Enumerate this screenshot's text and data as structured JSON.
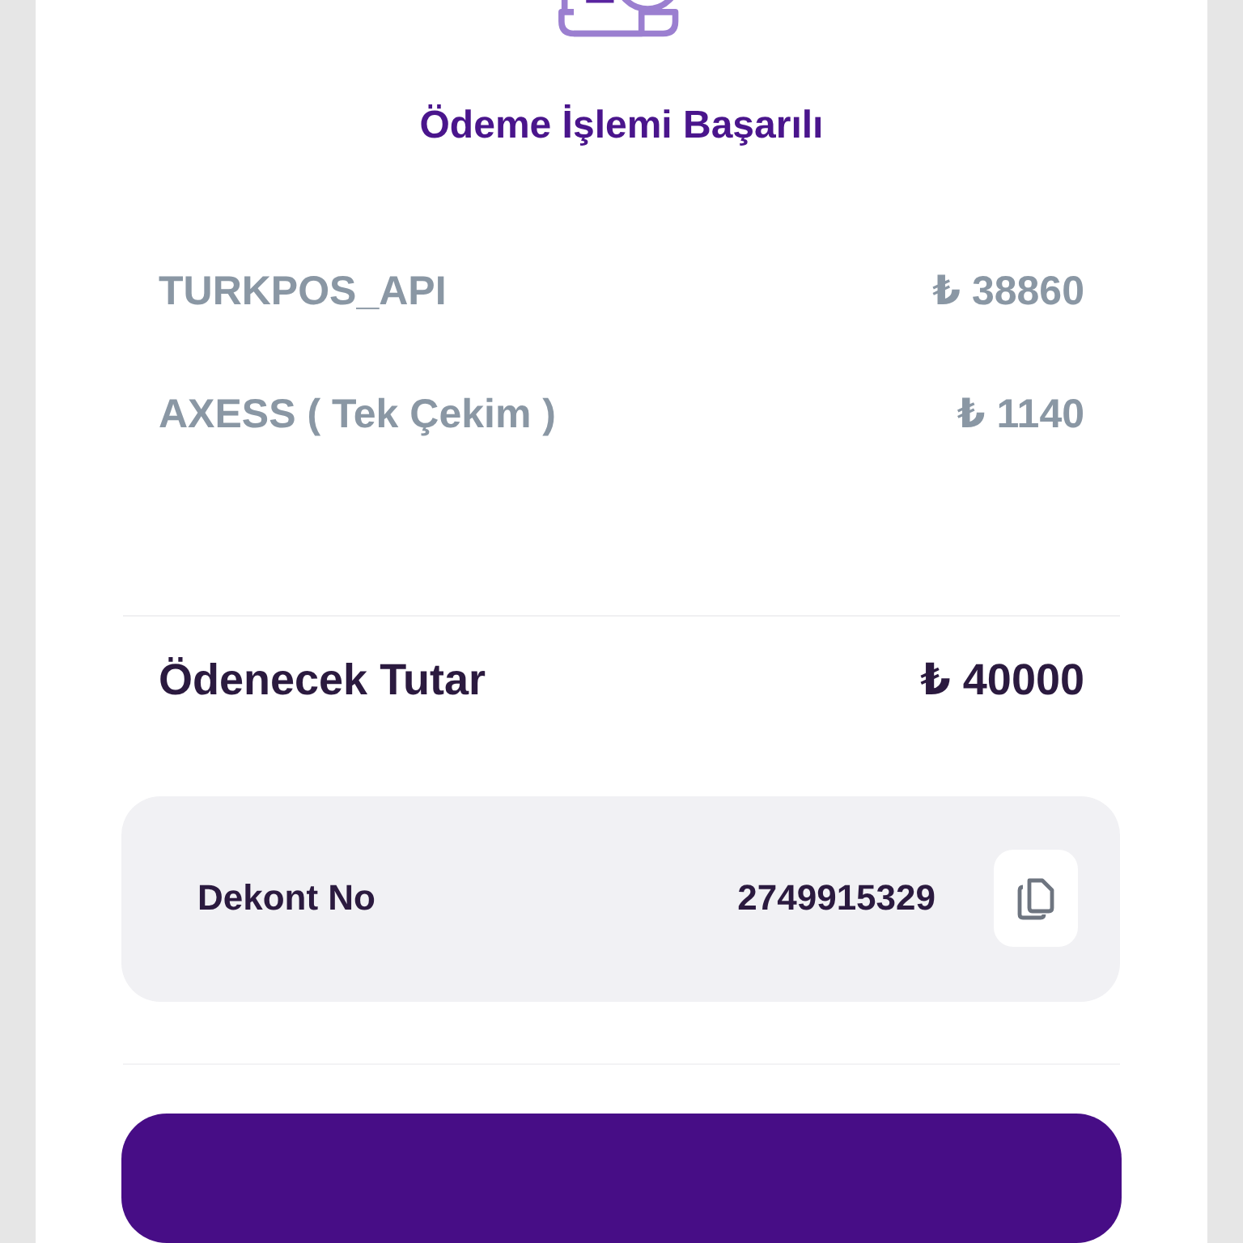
{
  "title": "Ödeme İşlemi Başarılı",
  "items": [
    {
      "label": "TURKPOS_API",
      "amount": "₺ 38860"
    },
    {
      "label": "AXESS ( Tek Çekim )",
      "amount": "₺ 1140"
    }
  ],
  "total": {
    "label": "Ödenecek Tutar",
    "amount": "₺ 40000"
  },
  "receipt": {
    "label": "Dekont No",
    "value": "2749915329"
  }
}
